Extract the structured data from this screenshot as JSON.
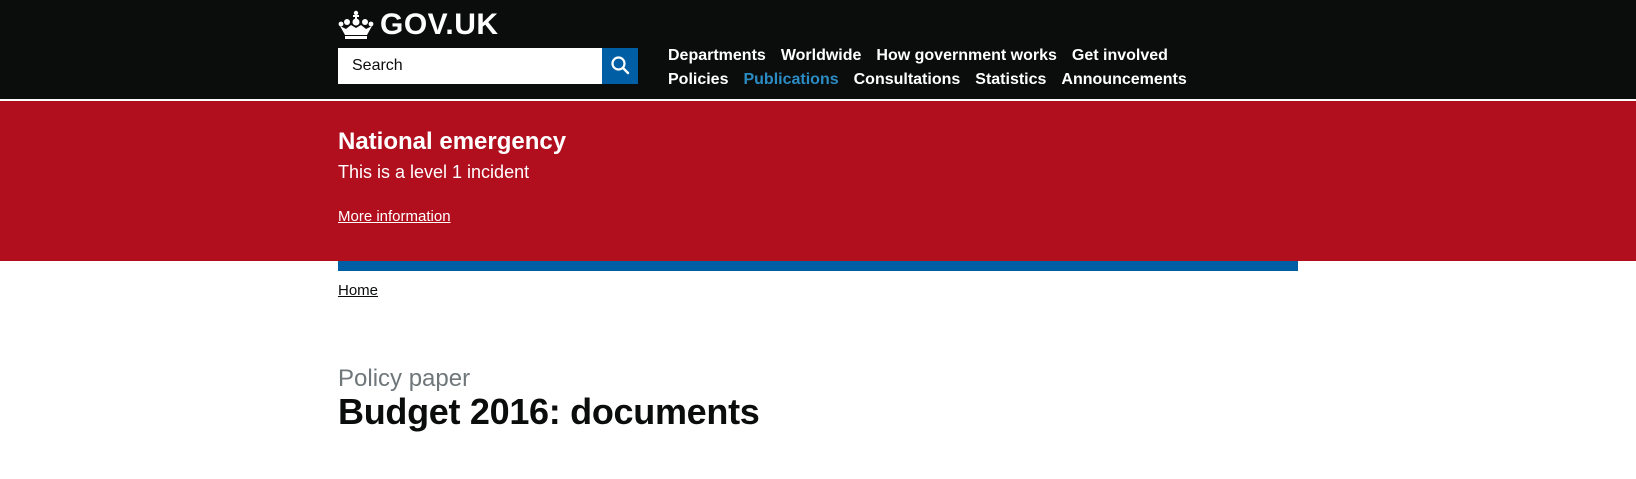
{
  "header": {
    "logo_text": "GOV.UK",
    "search": {
      "placeholder": "Search",
      "button_icon": "search-icon"
    },
    "nav": {
      "row1": [
        "Departments",
        "Worldwide",
        "How government works",
        "Get involved"
      ],
      "row2": [
        "Policies",
        "Publications",
        "Consultations",
        "Statistics",
        "Announcements"
      ],
      "active": "Publications"
    }
  },
  "emergency_banner": {
    "title": "National emergency",
    "description": "This is a level 1 incident",
    "link_text": "More information"
  },
  "breadcrumb": {
    "home": "Home"
  },
  "page": {
    "document_type": "Policy paper",
    "title": "Budget 2016: documents"
  },
  "colors": {
    "header_bg": "#0b0c0c",
    "emergency_bg": "#b10e1e",
    "brand_blue": "#005ea5",
    "active_link": "#2b8cc4",
    "secondary_text": "#6f777b"
  }
}
